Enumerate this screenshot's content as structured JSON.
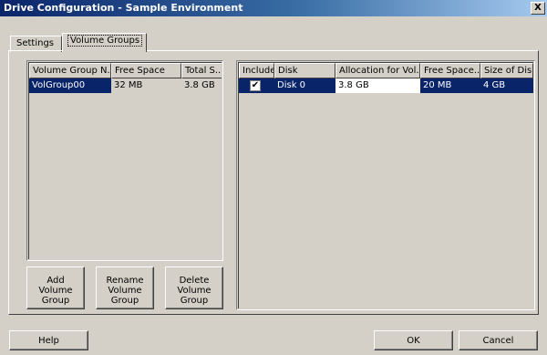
{
  "window": {
    "title": "Drive Configuration - Sample Environment",
    "close_label": "X"
  },
  "tabs": [
    {
      "label": "Settings",
      "active": false
    },
    {
      "label": "Volume Groups",
      "active": true
    }
  ],
  "volume_groups": {
    "columns": [
      "Volume Group N...",
      "Free Space",
      "Total S..."
    ],
    "rows": [
      {
        "name": "VolGroup00",
        "free": "32 MB",
        "total": "3.8 GB",
        "selected": true
      }
    ]
  },
  "group_buttons": [
    {
      "line1": "Add",
      "line2": "Volume",
      "line3": "Group"
    },
    {
      "line1": "Rename",
      "line2": "Volume",
      "line3": "Group"
    },
    {
      "line1": "Delete",
      "line2": "Volume",
      "line3": "Group"
    }
  ],
  "disks": {
    "columns": [
      "Include",
      "Disk",
      "Allocation for Vol...",
      "Free Space...",
      "Size of Disk"
    ],
    "rows": [
      {
        "include": true,
        "check_glyph": "✔",
        "disk": "Disk 0",
        "allocation": "3.8 GB",
        "free": "20 MB",
        "size": "4 GB"
      }
    ]
  },
  "footer": {
    "help": "Help",
    "ok": "OK",
    "cancel": "Cancel"
  }
}
